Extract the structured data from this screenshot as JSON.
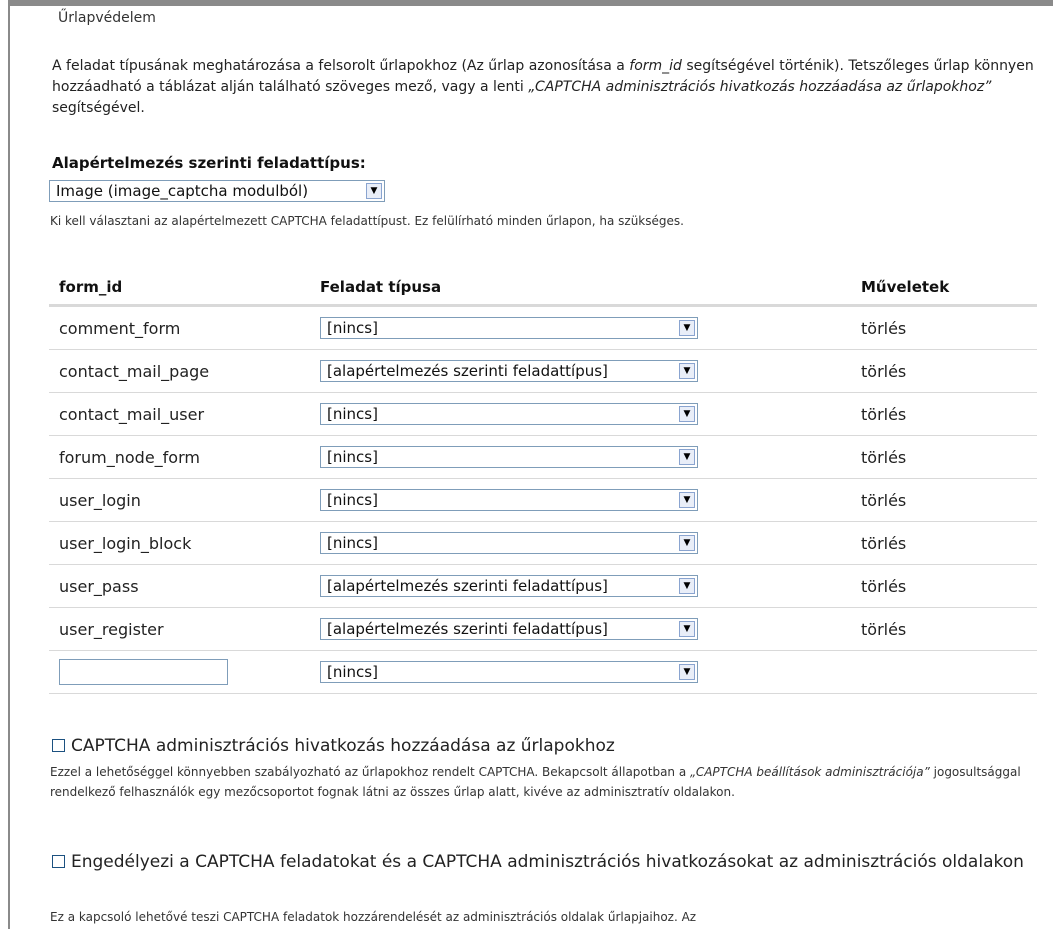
{
  "section_title": "Űrlapvédelem",
  "description": {
    "part1": "A feladat típusának meghatározása a felsorolt űrlapokhoz (Az űrlap azonosítása a ",
    "form_id_em": "form_id",
    "part2": " segítségével történik). Tetszőleges űrlap könnyen hozzáadható a táblázat alján található szöveges mező, vagy a lenti ",
    "link_em": "„CAPTCHA adminisztrációs hivatkozás hozzáadása az űrlapokhoz”",
    "part3": " segítségével."
  },
  "default_challenge": {
    "label": "Alapértelmezés szerinti feladattípus:",
    "selected": "Image (image_captcha modulból)",
    "help": "Ki kell választani az alapértelmezett CAPTCHA feladattípust. Ez felülírható minden űrlapon, ha szükséges."
  },
  "table": {
    "headers": {
      "form_id": "form_id",
      "type": "Feladat típusa",
      "ops": "Műveletek"
    },
    "rows": [
      {
        "form_id": "comment_form",
        "type": "[nincs]",
        "op": "törlés"
      },
      {
        "form_id": "contact_mail_page",
        "type": "[alapértelmezés szerinti feladattípus]",
        "op": "törlés"
      },
      {
        "form_id": "contact_mail_user",
        "type": "[nincs]",
        "op": "törlés"
      },
      {
        "form_id": "forum_node_form",
        "type": "[nincs]",
        "op": "törlés"
      },
      {
        "form_id": "user_login",
        "type": "[nincs]",
        "op": "törlés"
      },
      {
        "form_id": "user_login_block",
        "type": "[nincs]",
        "op": "törlés"
      },
      {
        "form_id": "user_pass",
        "type": "[alapértelmezés szerinti feladattípus]",
        "op": "törlés"
      },
      {
        "form_id": "user_register",
        "type": "[alapértelmezés szerinti feladattípus]",
        "op": "törlés"
      }
    ],
    "new_row": {
      "form_id_value": "",
      "type": "[nincs]"
    }
  },
  "checkbox_admin_links": {
    "label": "CAPTCHA adminisztrációs hivatkozás hozzáadása az űrlapokhoz",
    "checked": false,
    "help_part1": "Ezzel a lehetőséggel könnyebben szabályozható az űrlapokhoz rendelt CAPTCHA. Bekapcsolt állapotban a ",
    "help_em": "„CAPTCHA beállítások adminisztrációja”",
    "help_part2": " jogosultsággal rendelkező felhasználók egy mezőcsoportot fognak látni az összes űrlap alatt, kivéve az adminisztratív oldalakon."
  },
  "checkbox_admin_pages": {
    "label": "Engedélyezi a CAPTCHA feladatokat és a CAPTCHA adminisztrációs hivatkozásokat az adminisztrációs oldalakon",
    "checked": false,
    "help": "Ez a kapcsoló lehetővé teszi CAPTCHA feladatok hozzárendelését az adminisztrációs oldalak űrlapjaihoz. Az"
  },
  "icons": {
    "dropdown": "chevron-down-icon",
    "checkbox": "checkbox-icon"
  }
}
